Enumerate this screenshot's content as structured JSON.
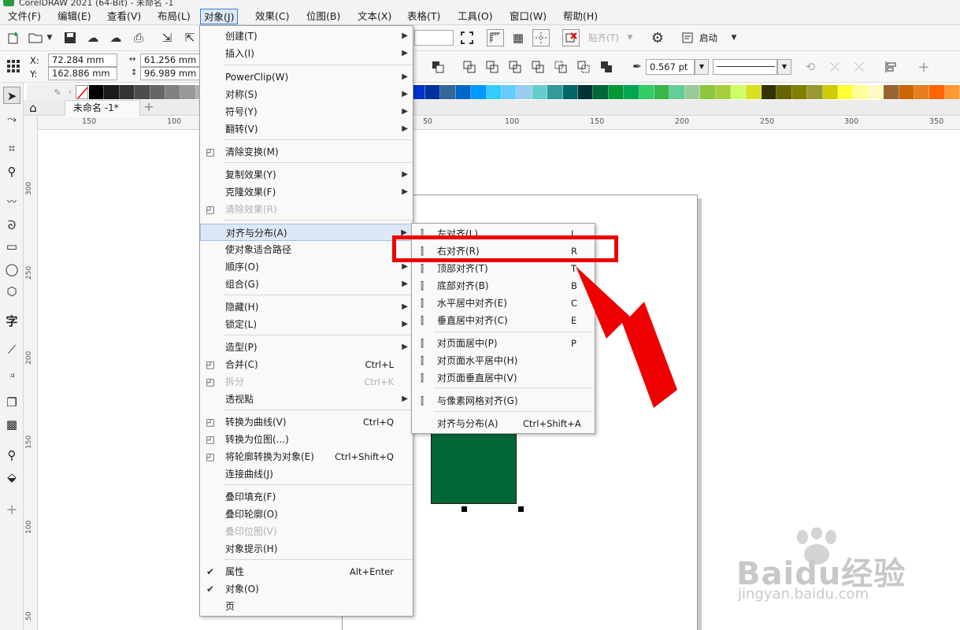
{
  "window": {
    "title": "CorelDRAW 2021 (64-Bit) - 未命名 -1"
  },
  "menubar": [
    {
      "label": "文件(F)"
    },
    {
      "label": "编辑(E)"
    },
    {
      "label": "查看(V)"
    },
    {
      "label": "布局(L)"
    },
    {
      "label": "对象(J)"
    },
    {
      "label": "效果(C)"
    },
    {
      "label": "位图(B)"
    },
    {
      "label": "文本(X)"
    },
    {
      "label": "表格(T)"
    },
    {
      "label": "工具(O)"
    },
    {
      "label": "窗口(W)"
    },
    {
      "label": "帮助(H)"
    }
  ],
  "toolbar": {
    "snap_label": "贴齐(T)",
    "launch_label": "启动"
  },
  "property_bar": {
    "x_label": "X:",
    "x_value": "72.284 mm",
    "y_label": "Y:",
    "y_value": "162.886 mm",
    "width_value": "61.256 mm",
    "height_value": "96.989 mm",
    "outline_width": "0.567 pt"
  },
  "document_tab": {
    "label": "未命名 -1*"
  },
  "ruler_h_ticks": [
    "150",
    "100",
    "50",
    "100",
    "150",
    "200",
    "250",
    "300",
    "350"
  ],
  "ruler_v_ticks": [
    "300",
    "250",
    "200",
    "150",
    "100",
    "50"
  ],
  "palette": [
    "#ffffff",
    "#000000",
    "#1a1a1a",
    "#333333",
    "#4d4d4d",
    "#666666",
    "#808080",
    "#999999",
    "#b3b3b3",
    "#cccccc",
    "#e6e6e6",
    "#ffffff",
    "#c0392b",
    "#e74c3c",
    "#ff0000",
    "#ff3366",
    "#ff66cc",
    "#cc33ff",
    "#9933ff",
    "#6633cc",
    "#3333cc",
    "#3366ff",
    "#0033cc",
    "#003399",
    "#336699",
    "#0066cc",
    "#0099ff",
    "#33ccff",
    "#66ccff",
    "#99ccee",
    "#66cccc",
    "#339999",
    "#006666",
    "#003333",
    "#006837",
    "#009933",
    "#00a651",
    "#33cc66",
    "#39b54a",
    "#66cc99",
    "#99cc99",
    "#8dc63f",
    "#a6ce39",
    "#ccff66",
    "#d9e021",
    "#333300",
    "#666600",
    "#808000",
    "#999933",
    "#cccc00",
    "#ffff33",
    "#ffff99",
    "#fff9c4",
    "#996633",
    "#cc6600",
    "#e67e22",
    "#ff6600",
    "#ff9933"
  ],
  "object_menu": {
    "items": [
      {
        "label": "创建(T)",
        "arrow": true
      },
      {
        "label": "插入(I)",
        "arrow": true
      },
      {
        "label": "PowerClip(W)",
        "arrow": true
      },
      {
        "label": "对称(S)",
        "arrow": true
      },
      {
        "label": "符号(Y)",
        "arrow": true
      },
      {
        "label": "翻转(V)",
        "arrow": true
      },
      {
        "label": "清除变换(M)",
        "icon": "clear-transform-icon"
      },
      {
        "label": "复制效果(Y)",
        "arrow": true
      },
      {
        "label": "克隆效果(F)",
        "arrow": true
      },
      {
        "label": "清除效果(R)",
        "disabled": true,
        "icon": "clear-effect-icon"
      },
      {
        "label": "对齐与分布(A)",
        "arrow": true,
        "highlighted": true
      },
      {
        "label": "使对象适合路径"
      },
      {
        "label": "顺序(O)",
        "arrow": true
      },
      {
        "label": "组合(G)",
        "arrow": true
      },
      {
        "label": "隐藏(H)",
        "arrow": true
      },
      {
        "label": "锁定(L)",
        "arrow": true
      },
      {
        "label": "造型(P)",
        "arrow": true
      },
      {
        "label": "合并(C)",
        "shortcut": "Ctrl+L",
        "icon": "combine-icon"
      },
      {
        "label": "拆分",
        "shortcut": "Ctrl+K",
        "disabled": true,
        "icon": "break-apart-icon"
      },
      {
        "label": "透视點",
        "arrow": true
      },
      {
        "label": "转换为曲线(V)",
        "shortcut": "Ctrl+Q",
        "icon": "convert-curves-icon"
      },
      {
        "label": "转换为位图(...)",
        "icon": "convert-bitmap-icon"
      },
      {
        "label": "将轮廓转换为对象(E)",
        "shortcut": "Ctrl+Shift+Q",
        "icon": "outline-object-icon"
      },
      {
        "label": "连接曲线(J)"
      },
      {
        "label": "叠印填充(F)"
      },
      {
        "label": "叠印轮廓(O)"
      },
      {
        "label": "叠印位图(V)",
        "disabled": true
      },
      {
        "label": "对象提示(H)"
      },
      {
        "label": "属性",
        "shortcut": "Alt+Enter",
        "check": true
      },
      {
        "label": "对象(O)",
        "check": true
      },
      {
        "label": "页"
      }
    ]
  },
  "align_submenu": {
    "items": [
      {
        "label": "左对齐(L)",
        "shortcut": "L",
        "icon": "align-left-icon"
      },
      {
        "label": "右对齐(R)",
        "shortcut": "R",
        "icon": "align-right-icon"
      },
      {
        "label": "顶部对齐(T)",
        "shortcut": "T",
        "icon": "align-top-icon"
      },
      {
        "label": "底部对齐(B)",
        "shortcut": "B",
        "icon": "align-bottom-icon"
      },
      {
        "label": "水平居中对齐(E)",
        "shortcut": "C",
        "icon": "align-hcenter-icon"
      },
      {
        "label": "垂直居中对齐(C)",
        "shortcut": "E",
        "icon": "align-vcenter-icon"
      },
      {
        "label": "对页面居中(P)",
        "shortcut": "P",
        "icon": "page-center-icon"
      },
      {
        "label": "对页面水平居中(H)",
        "icon": "page-hcenter-icon"
      },
      {
        "label": "对页面垂直居中(V)",
        "icon": "page-vcenter-icon"
      },
      {
        "label": "与像素网格对齐(G)",
        "icon": "pixel-grid-icon"
      },
      {
        "label": "对齐与分布(A)",
        "shortcut": "Ctrl+Shift+A"
      }
    ]
  },
  "watermark": {
    "brand": "Baidu经验",
    "url": "jingyan.baidu.com"
  },
  "colors": {
    "accent_highlight": "#dde8f6",
    "callout_red": "#ee0000",
    "shape_fill": "#006837"
  }
}
